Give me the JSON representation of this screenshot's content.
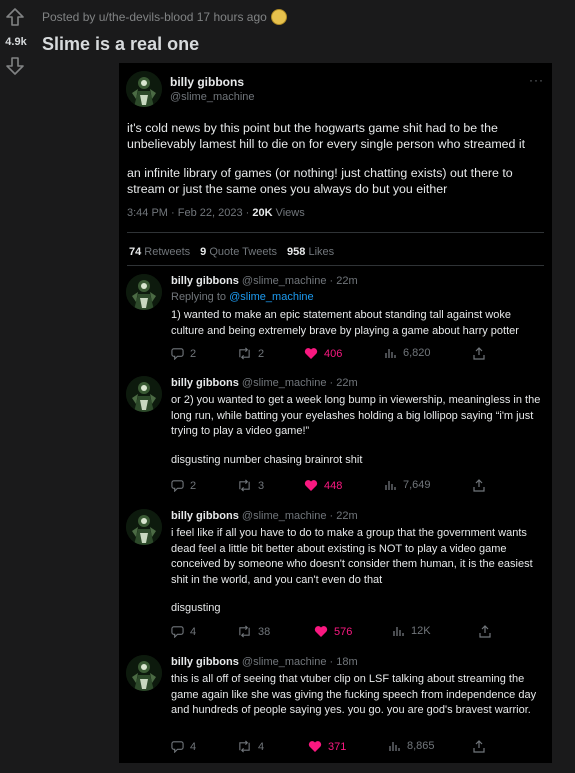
{
  "post": {
    "score": "4.9k",
    "meta": "Posted by u/the-devils-blood 17 hours ago",
    "title": "Slime is a real one"
  },
  "tweet": {
    "name": "billy gibbons",
    "handle": "@slime_machine",
    "more": "···",
    "paragraphs": [
      "it's cold news by this point but the hogwarts game shit had to be the unbelievably lamest hill to die on for every single person who streamed it",
      "an infinite library of games (or nothing! just chatting exists) out there to stream or just the same ones you always do but you either"
    ],
    "time": "3:44 PM · Feb 22, 2023 · ",
    "views_count": "20K",
    "views_label": " Views",
    "retweets_count": "74",
    "retweets_label": " Retweets",
    "quotes_count": "9",
    "quotes_label": " Quote Tweets",
    "likes_count": "958",
    "likes_label": " Likes"
  },
  "replies": [
    {
      "name": "billy gibbons",
      "meta": "@slime_machine · 22m",
      "replying_label": "Replying to ",
      "replying_handle": "@slime_machine",
      "paragraphs": [
        "1) wanted to make an epic statement about standing tall against woke culture and being extremely brave by playing a game about harry potter"
      ],
      "replies": "2",
      "retweets": "2",
      "likes": "406",
      "views": "6,820"
    },
    {
      "name": "billy gibbons",
      "meta": "@slime_machine · 22m",
      "paragraphs": [
        "or 2) you wanted to get a week long bump in viewership, meaningless in the long run, while batting your eyelashes holding a big lollipop saying “i'm just trying to play a video game!”",
        "disgusting number chasing brainrot shit"
      ],
      "replies": "2",
      "retweets": "3",
      "likes": "448",
      "views": "7,649"
    },
    {
      "name": "billy gibbons",
      "meta": "@slime_machine · 22m",
      "paragraphs": [
        "i feel like if all you have to do to make a group that the government wants dead feel a little bit better about existing is NOT to play a video game conceived by someone who doesn't consider them human, it is the easiest shit in the world, and you can't even do that",
        "disgusting"
      ],
      "replies": "4",
      "retweets": "38",
      "likes": "576",
      "views": "12K"
    },
    {
      "name": "billy gibbons",
      "meta": "@slime_machine · 18m",
      "paragraphs": [
        "this is all off of seeing that vtuber clip on LSF talking about streaming the game again like she was giving the fucking speech from independence day and hundreds of people saying yes. you go. you are god's bravest warrior."
      ],
      "replies": "4",
      "retweets": "4",
      "likes": "371",
      "views": "8,865"
    }
  ],
  "colors": {
    "background": "#1a1a1b",
    "card": "#000000",
    "like": "#f91880",
    "link": "#1d9bf0",
    "muted": "#71767b"
  },
  "icons": [
    "upvote-arrow-icon",
    "downvote-arrow-icon",
    "award-icon",
    "reply-icon",
    "retweet-icon",
    "heart-icon",
    "views-icon",
    "share-icon"
  ]
}
